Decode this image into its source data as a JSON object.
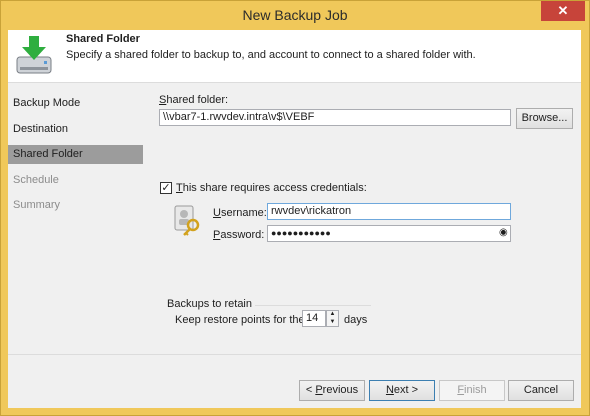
{
  "window": {
    "title": "New Backup Job",
    "close_glyph": "✕"
  },
  "header": {
    "title": "Shared Folder",
    "subtitle": "Specify a shared folder to backup to, and account to connect to a shared folder with.",
    "icon": "download-drive-icon"
  },
  "sidebar": {
    "items": [
      {
        "label": "Backup Mode",
        "state": "normal"
      },
      {
        "label": "Destination",
        "state": "normal"
      },
      {
        "label": "Shared Folder",
        "state": "active"
      },
      {
        "label": "Schedule",
        "state": "disabled"
      },
      {
        "label": "Summary",
        "state": "disabled"
      }
    ]
  },
  "form": {
    "shared_folder_label_u": "S",
    "shared_folder_label_rest": "hared folder:",
    "shared_folder_value": "\\\\vbar7-1.rwvdev.intra\\v$\\VEBF",
    "browse_label": "Browse...",
    "credentials_check_label_u": "T",
    "credentials_check_label_rest": "his share requires access credentials:",
    "credentials_checked": true,
    "check_glyph": "✓",
    "username_label_u": "U",
    "username_label_rest": "sername:",
    "username_value": "rwvdev\\rickatron",
    "password_label_u": "P",
    "password_label_rest": "assword:",
    "password_value": "●●●●●●●●●●●",
    "reveal_glyph": "◉",
    "credentials_icon": "key-user-icon"
  },
  "retention": {
    "group_label": "Backups to retain",
    "keep_label": "Keep restore points for the last",
    "days_value": "14",
    "days_unit": "days",
    "up_glyph": "▲",
    "down_glyph": "▼"
  },
  "footer": {
    "previous_label_u": "P",
    "previous_label_rest": "revious",
    "previous_arrow": "< ",
    "next_label_u": "N",
    "next_label_rest": "ext",
    "next_arrow": " >",
    "finish_label_u": "F",
    "finish_label_rest": "inish",
    "cancel_label": "Cancel"
  },
  "colors": {
    "titlebar": "#f0c85a",
    "close_button": "#c7443a",
    "active_nav": "#9c9c9c"
  }
}
